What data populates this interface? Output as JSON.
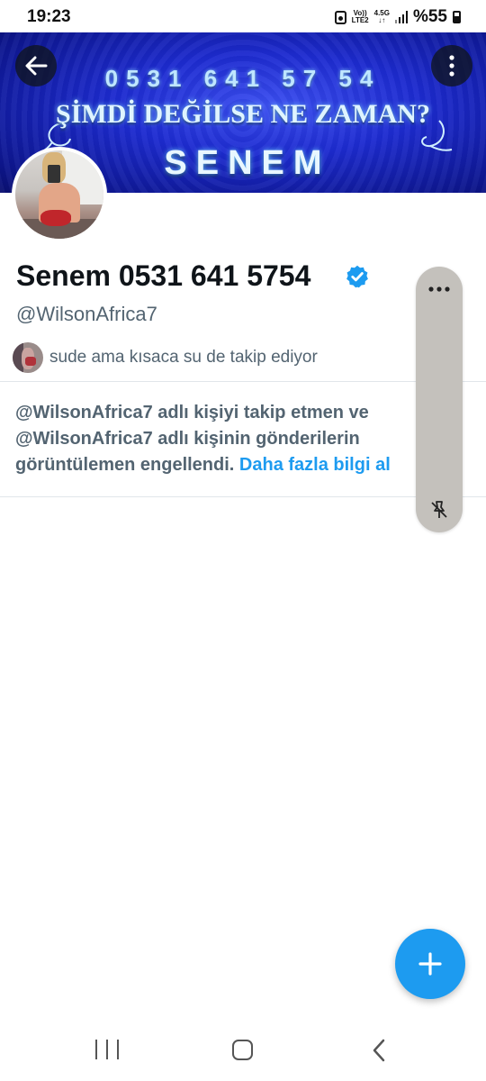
{
  "status_bar": {
    "time": "19:23",
    "network_volte": "Vo))",
    "network_lte": "LTE2",
    "network_type": "4.5G",
    "battery": "%55"
  },
  "banner": {
    "phone": "0531 641 57 54",
    "slogan": "ŞİMDİ DEĞİLSE NE ZAMAN?",
    "name": "SENEM",
    "background_color": "#1d2bd0"
  },
  "header": {
    "back_icon": "arrow-left-icon",
    "more_icon": "more-vertical-icon"
  },
  "profile": {
    "display_name": "Senem 0531 641 5754",
    "verified_icon": "verified-badge-icon",
    "handle": "@WilsonAfrica7",
    "followers_you_know": "sude ama kısaca su de takip ediyor"
  },
  "blocked_notice": {
    "line1": "@WilsonAfrica7 adlı kişiyi takip etmen ve",
    "line2": "@WilsonAfrica7 adlı kişinin gönderilerin",
    "line3": "görüntülemen engellendi.",
    "learn_more": "Daha fazla bilgi al"
  },
  "side_panel": {
    "menu_icon": "more-horizontal-icon",
    "unpin_icon": "unpin-icon"
  },
  "fab": {
    "icon": "plus-icon",
    "color": "#1d9bf0"
  },
  "nav_bar": {
    "recents_icon": "recents-icon",
    "home_icon": "home-icon",
    "back_icon": "back-chevron-icon"
  },
  "colors": {
    "accent": "#1d9bf0",
    "secondary_text": "#536471",
    "primary_text": "#0f1419"
  }
}
